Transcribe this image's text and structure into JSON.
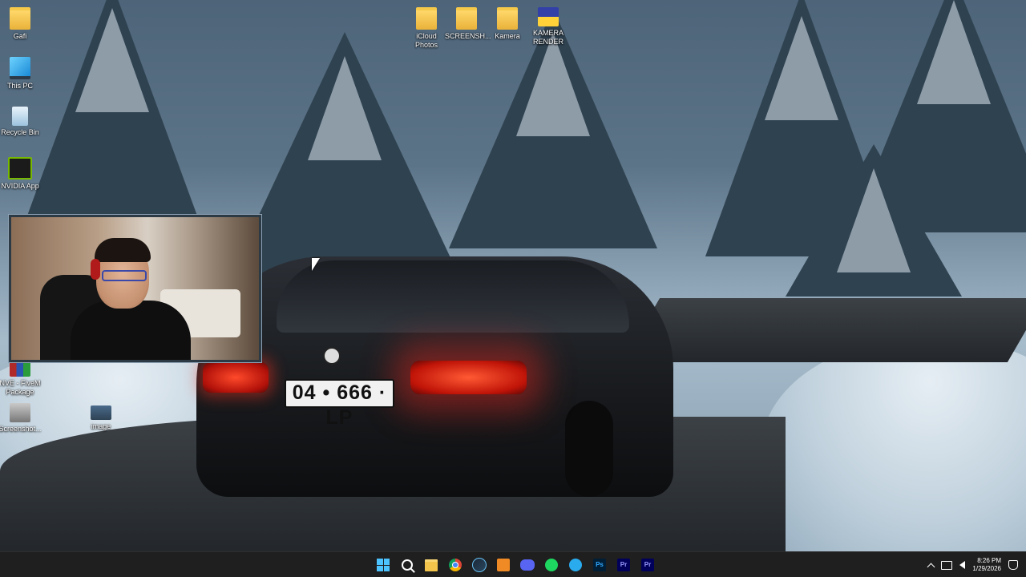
{
  "wallpaper": {
    "plate_text": "04 • 666 · LP"
  },
  "desktop_icons": [
    {
      "id": "gafi",
      "label": "Gafi",
      "icon": "folder-icon"
    },
    {
      "id": "this-pc",
      "label": "This PC",
      "icon": "monitor-icon"
    },
    {
      "id": "recycle-bin",
      "label": "Recycle Bin",
      "icon": "recycle-bin-icon"
    },
    {
      "id": "nvidia-app",
      "label": "NVIDIA App",
      "icon": "nvidia-icon"
    },
    {
      "id": "nve-fivem",
      "label": "NVE - FiveM Package",
      "icon": "winrar-archive-icon"
    },
    {
      "id": "screenshot",
      "label": "Screenshot...",
      "icon": "screenshot-file-icon"
    },
    {
      "id": "image",
      "label": "image",
      "icon": "image-file-icon"
    },
    {
      "id": "icloud-photos",
      "label": "iCloud Photos",
      "icon": "folder-icon"
    },
    {
      "id": "screensh",
      "label": "SCREENSH...",
      "icon": "folder-icon"
    },
    {
      "id": "kamera",
      "label": "Kamera",
      "icon": "folder-icon"
    },
    {
      "id": "kamera-render",
      "label": "KAMERA RENDER",
      "icon": "folder-icon"
    }
  ],
  "taskbar": {
    "apps": [
      {
        "id": "start",
        "icon": "windows-start-icon"
      },
      {
        "id": "search",
        "icon": "search-icon"
      },
      {
        "id": "file-explorer",
        "icon": "file-explorer-icon"
      },
      {
        "id": "chrome",
        "icon": "chrome-icon"
      },
      {
        "id": "steam",
        "icon": "steam-icon"
      },
      {
        "id": "after-effects",
        "icon": "after-effects-icon"
      },
      {
        "id": "discord",
        "icon": "discord-icon"
      },
      {
        "id": "spotify",
        "icon": "spotify-icon"
      },
      {
        "id": "telegram",
        "icon": "telegram-icon"
      },
      {
        "id": "photoshop",
        "icon": "photoshop-icon",
        "text": "Ps"
      },
      {
        "id": "premiere-1",
        "icon": "premiere-pro-icon",
        "text": "Pr"
      },
      {
        "id": "premiere-2",
        "icon": "premiere-pro-icon",
        "text": "Pr"
      }
    ],
    "clock": {
      "time": "8:26 PM",
      "date": "1/29/2026"
    }
  }
}
